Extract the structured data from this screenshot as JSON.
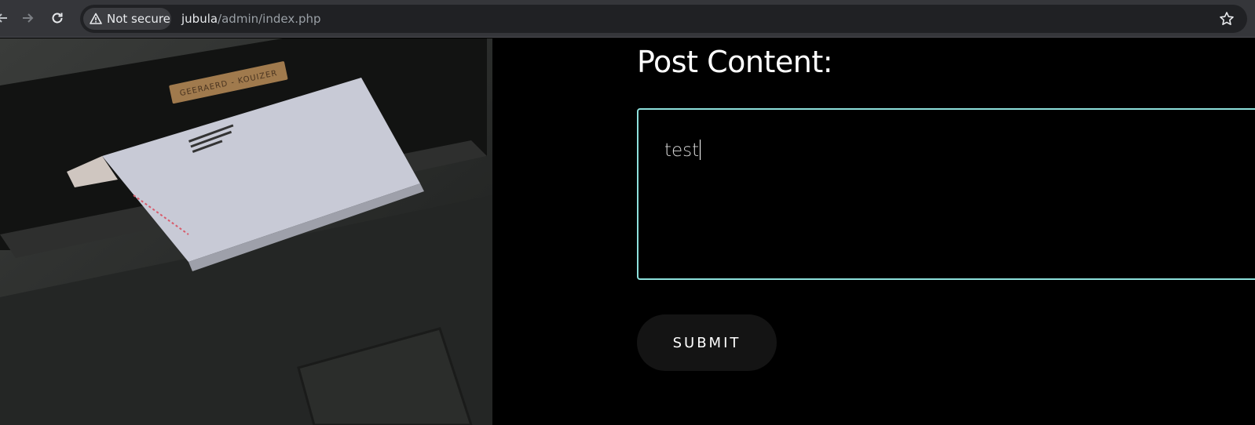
{
  "browser": {
    "security_label": "Not secure",
    "url_host": "jubula",
    "url_path": "/admin/index.php",
    "icons": [
      "back-arrow-icon",
      "forward-arrow-icon",
      "reload-icon",
      "warning-icon",
      "star-icon"
    ]
  },
  "photo": {
    "nameplate": "GEERAERD - KOUIZER"
  },
  "form": {
    "label": "Post Content:",
    "content_value": "test",
    "submit_label": "SUBMIT",
    "accent_color": "#8de0dc"
  }
}
